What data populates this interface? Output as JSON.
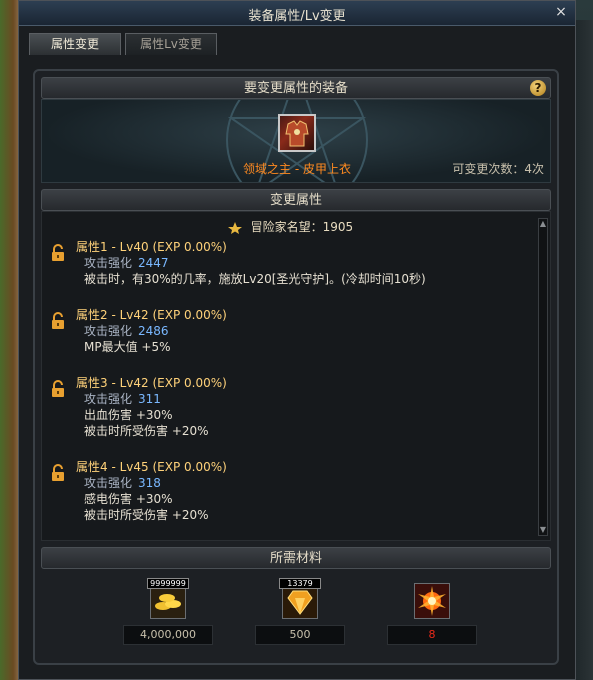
{
  "window": {
    "title": "装备属性/Lv变更",
    "close_label": "×"
  },
  "tabs": [
    {
      "label": "属性变更",
      "active": true
    },
    {
      "label": "属性Lv变更",
      "active": false
    }
  ],
  "equip_section": {
    "header": "要变更属性的装备",
    "help_label": "?",
    "item_name": "领域之主 - 皮甲上衣",
    "change_count": "可变更次数：4次"
  },
  "attr_section": {
    "header": "变更属性",
    "fame_label": "冒险家名望：1905",
    "attributes": [
      {
        "title": "属性1 - Lv40 (EXP 0.00%)",
        "lines": [
          {
            "label": "攻击强化",
            "value": "2447"
          },
          {
            "label": "被击时，有30%的几率，施放Lv20[圣光守护]。(冷却时间10秒)",
            "value": ""
          }
        ]
      },
      {
        "title": "属性2 - Lv42 (EXP 0.00%)",
        "lines": [
          {
            "label": "攻击强化",
            "value": "2486"
          },
          {
            "label": "MP最大值 +5%",
            "value": ""
          }
        ]
      },
      {
        "title": "属性3 - Lv42 (EXP 0.00%)",
        "lines": [
          {
            "label": "攻击强化",
            "value": "311"
          },
          {
            "label": "出血伤害 +30%",
            "value": ""
          },
          {
            "label": "被击时所受伤害 +20%",
            "value": ""
          }
        ]
      },
      {
        "title": "属性4 - Lv45 (EXP 0.00%)",
        "lines": [
          {
            "label": "攻击强化",
            "value": "318"
          },
          {
            "label": "感电伤害 +30%",
            "value": ""
          },
          {
            "label": "被击时所受伤害 +20%",
            "value": ""
          }
        ]
      }
    ]
  },
  "materials_section": {
    "header": "所需材料",
    "items": [
      {
        "icon": "gold-coins-icon",
        "badge": "9999999",
        "value": "4,000,000",
        "color": "#c8c0ac"
      },
      {
        "icon": "crystal-icon",
        "badge": "13379",
        "value": "500",
        "color": "#c8c0ac"
      },
      {
        "icon": "burst-icon",
        "badge": "",
        "value": "8",
        "color": "#e82a1a"
      }
    ]
  },
  "colors": {
    "item_name": "#ff8a20",
    "attr_title": "#ffd27a",
    "attr_value": "#7ab8ff",
    "insufficient": "#e82a1a"
  }
}
